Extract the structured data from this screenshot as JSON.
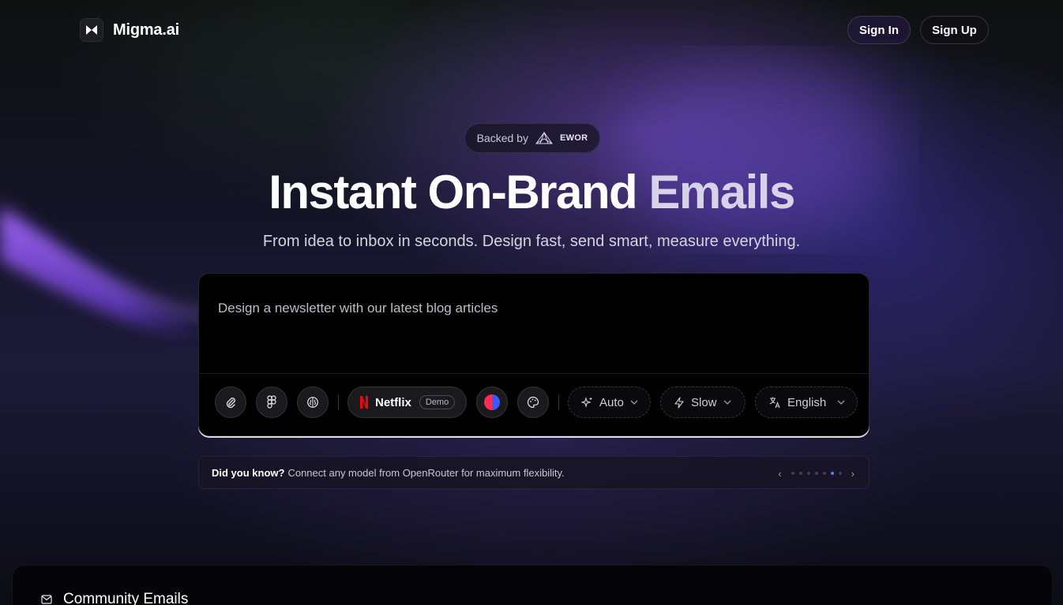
{
  "header": {
    "logo_text": "Migma.ai",
    "sign_in": "Sign In",
    "sign_up": "Sign Up"
  },
  "badge": {
    "label": "Backed by",
    "brand": "EWOR"
  },
  "hero": {
    "title_main": "Instant On-Brand",
    "title_highlight": "Emails",
    "subtitle": "From idea to inbox in seconds. Design fast, send smart, measure everything."
  },
  "prompt": {
    "placeholder": "Design a newsletter with our latest blog articles",
    "toolbar": {
      "attach_icon": "paperclip-icon",
      "figma_icon": "figma-icon",
      "brain_icon": "brain-icon",
      "brand_name": "Netflix",
      "brand_tag": "Demo",
      "color_icon": "color-split-icon",
      "palette_icon": "palette-icon",
      "mode_label": "Auto",
      "speed_label": "Slow",
      "language_label": "English"
    }
  },
  "tip": {
    "prefix": "Did you know?",
    "text": "Connect any model from OpenRouter for maximum flexibility.",
    "dots_total": 7,
    "dots_active_index": 5
  },
  "community": {
    "title": "Community Emails",
    "icon": "mail-icon"
  },
  "colors": {
    "accent": "#5b7bff",
    "netflix": "#e50914"
  }
}
